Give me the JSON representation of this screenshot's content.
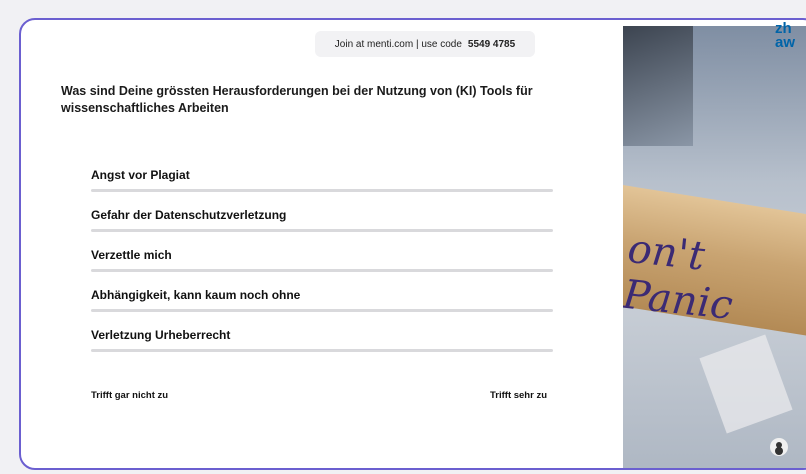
{
  "join": {
    "text": "Join at menti.com | use code",
    "code": "5549 4785"
  },
  "question": "Was sind Deine grössten Herausforderungen bei der Nutzung von (KI) Tools für wissenschaftliches Arbeiten",
  "items": [
    {
      "label": "Angst vor Plagiat"
    },
    {
      "label": "Gefahr der Datenschutzverletzung"
    },
    {
      "label": "Verzettle mich"
    },
    {
      "label": "Abhängigkeit, kann kaum noch ohne"
    },
    {
      "label": "Verletzung Urheberrecht"
    }
  ],
  "scale": {
    "left": "Trifft gar nicht zu",
    "right": "Trifft sehr zu"
  },
  "image": {
    "text": "on't Panic"
  },
  "logo": {
    "line1": "zh",
    "line2": "aw"
  },
  "colors": {
    "accent": "#6b5fd0",
    "logo": "#0064a8"
  }
}
